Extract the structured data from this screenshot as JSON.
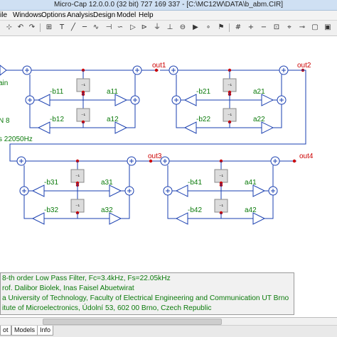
{
  "window": {
    "title": "Micro-Cap 12.0.0.0 (32 bit) 727 169 337 - [C:\\MC12W\\DATA\\b_abm.CIR]"
  },
  "menu": {
    "items": [
      "ile",
      "Windows",
      "Options",
      "Analysis",
      "Design",
      "Model",
      "Help"
    ]
  },
  "toolbar": {
    "icons": [
      "select-icon",
      "undo-icon",
      "redo-icon",
      "component-icon",
      "text-icon",
      "wire-icon",
      "resistor-icon",
      "capacitor-icon",
      "inductor-icon",
      "diode-icon",
      "transistor-icon",
      "ground-icon",
      "flag-icon",
      "grid-icon"
    ]
  },
  "schematic": {
    "left_labels": {
      "ain": "ain",
      "n8": "N 8",
      "fs": "s 22050Hz"
    },
    "nodes": {
      "out1": "out1",
      "out2": "out2",
      "out3": "out3",
      "out4": "out4"
    },
    "stage1": {
      "b1": "-b11",
      "b2": "-b12",
      "a1": "a11",
      "a2": "a12"
    },
    "stage2": {
      "b1": "-b21",
      "b2": "-b22",
      "a1": "a21",
      "a2": "a22"
    },
    "stage3": {
      "b1": "-b31",
      "b2": "-b32",
      "a1": "a31",
      "a2": "a32"
    },
    "stage4": {
      "b1": "-b41",
      "b2": "-b42",
      "a1": "a41",
      "a2": "a42"
    },
    "delay_symbol": "⁻¹"
  },
  "info": {
    "line1": "8-th order Low Pass Filter, Fc=3.4kHz, Fs=22.05kHz",
    "line2": "rof. Dalibor Biolek, Inas Faisel Abuetwirat",
    "line3": "a University of Technology, Faculty of Electrical Engineering and Communication UT Brno",
    "line4": "itute of Microelectronics, Údolní 53, 602 00 Brno, Czech Republic"
  },
  "tabs": [
    "ot",
    "Models",
    "Info"
  ],
  "colors": {
    "wire": "#1a3fb0",
    "label": "#0a7a0a",
    "node": "#cc0000",
    "titlebar": "#cfe0f3"
  }
}
